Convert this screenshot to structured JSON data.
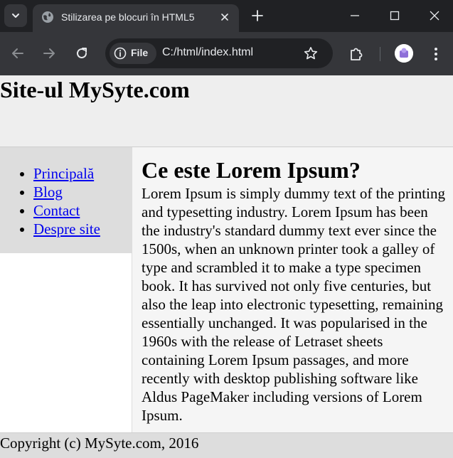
{
  "browser": {
    "tab_title": "Stilizarea pe blocuri în HTML5",
    "site_chip_label": "File",
    "url": "C:/html/index.html",
    "colors": {
      "tabbar_bg": "#202124",
      "toolbar_bg": "#35363a",
      "text": "#e8eaed"
    },
    "icons": {
      "tab_menu": "chevron-down-icon",
      "favicon": "globe-icon",
      "close": "close-icon",
      "new_tab": "plus-icon",
      "back": "arrow-left-icon",
      "forward": "arrow-right-icon",
      "reload": "reload-icon",
      "info": "info-icon",
      "bookmark": "star-icon",
      "extensions": "puzzle-icon",
      "menu": "kebab-menu-icon"
    }
  },
  "page": {
    "header_title": "Site-ul MySyte.com",
    "nav_items": [
      "Principală",
      "Blog",
      "Contact",
      "Despre site"
    ],
    "article_title": "Ce este Lorem Ipsum?",
    "article_text": "Lorem Ipsum is simply dummy text of the printing and typesetting industry. Lorem Ipsum has been the industry's standard dummy text ever since the 1500s, when an unknown printer took a galley of type and scrambled it to make a type specimen book. It has survived not only five centuries, but also the leap into electronic typesetting, remaining essentially unchanged. It was popularised in the 1960s with the release of Letraset sheets containing Lorem Ipsum passages, and more recently with desktop publishing software like Aldus PageMaker including versions of Lorem Ipsum.",
    "footer_text": "Copyright (c) MySyte.com, 2016",
    "colors": {
      "header_bg": "#eeeeee",
      "nav_bg": "#dddddd",
      "content_bg": "#f5f5f5",
      "footer_bg": "#dddddd",
      "link": "#0000ee"
    }
  }
}
